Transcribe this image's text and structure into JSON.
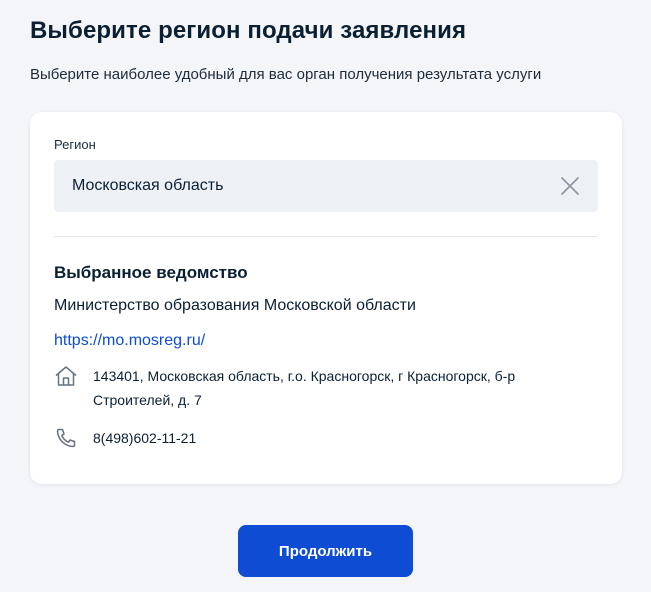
{
  "page": {
    "title": "Выберите регион подачи заявления",
    "subtitle": "Выберите наиболее удобный для вас орган получения результата услуги"
  },
  "region": {
    "label": "Регион",
    "value": "Московская область",
    "clear_icon": "close-icon"
  },
  "agency": {
    "heading": "Выбранное ведомство",
    "name": "Министерство образования Московской области",
    "link": "https://mo.mosreg.ru/",
    "address": "143401, Московская область, г.о. Красногорск, г Красногорск, б-р Строителей, д. 7",
    "address_icon": "house-icon",
    "phone": "8(498)602-11-21",
    "phone_icon": "phone-icon"
  },
  "actions": {
    "continue_label": "Продолжить"
  },
  "colors": {
    "accent": "#0d4cd3",
    "background": "#f3f5f9",
    "field_background": "#edf0f5",
    "icon_grey": "#66727f"
  }
}
